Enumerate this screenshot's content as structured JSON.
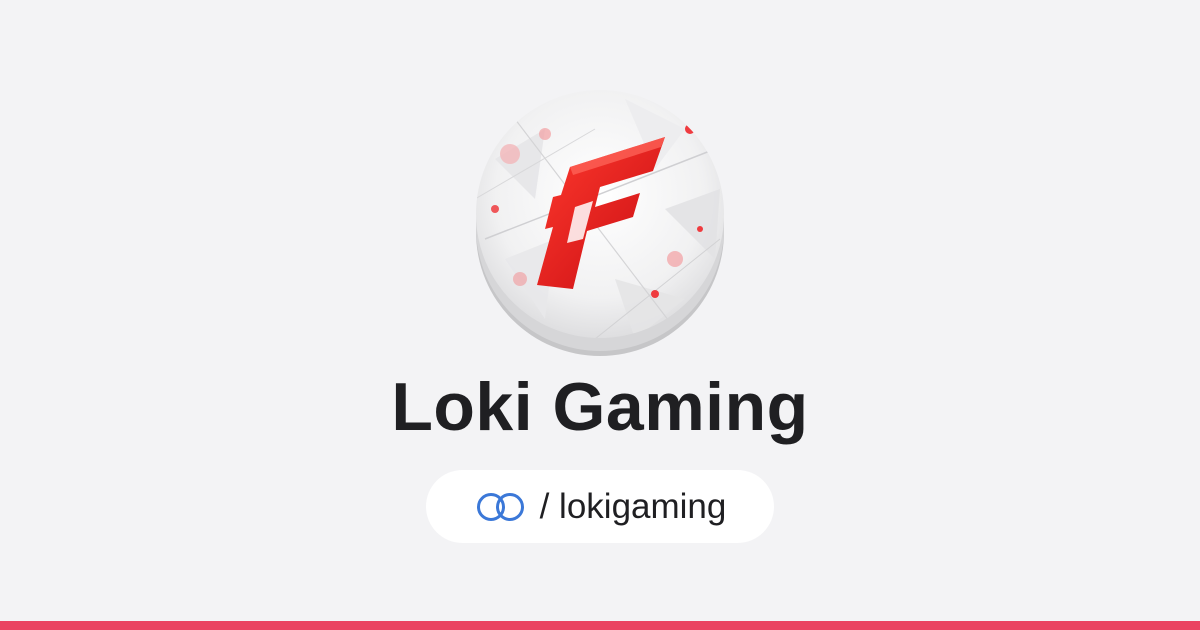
{
  "profile": {
    "name": "Loki Gaming",
    "handle": "/ lokigaming",
    "avatar_icon": "loki-gaming-logo-icon",
    "link_icon": "linktree-rings-icon"
  },
  "colors": {
    "background": "#f3f3f5",
    "accent_bar": "#ea4361",
    "link_icon": "#3b78d8",
    "logo_red": "#e0141a",
    "text": "#1f1f22"
  }
}
